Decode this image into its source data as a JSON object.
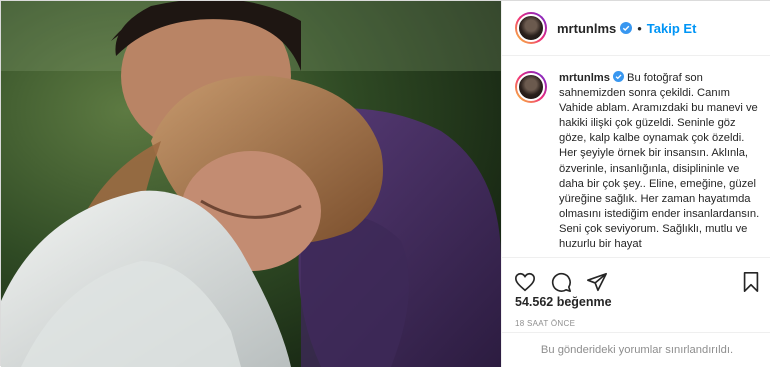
{
  "post": {
    "username": "mrtunlms",
    "follow_label": "Takip Et",
    "dot": "•",
    "caption_text": "Bu fotoğraf son sahnemizden sonra çekildi. Canım Vahide ablam. Aramızdaki bu manevi ve hakiki ilişki çok güzeldi. Seninle göz göze, kalp kalbe oynamak çok özeldi. Her şeyiyle örnek bir insansın. Aklınla, özverinle, insanlığınla, disiplininle ve daha bir çok şey.. Eline, emeğine, güzel yüreğine sağlık. Her zaman hayatımda olmasını istediğim ender insanlardansın. Seni çok seviyorum. Sağlıklı, mutlu ve huzurlu bir hayat",
    "likes": "54.562 beğenme",
    "time_ago": "18 SAAT ÖNCE",
    "comments_disabled": "Bu gönderideki yorumlar sınırlandırıldı."
  },
  "icons": {
    "verified": "verified-badge-icon",
    "like": "heart-icon",
    "comment": "comment-icon",
    "share": "share-icon",
    "save": "bookmark-icon"
  },
  "colors": {
    "accent": "#0095f6",
    "text": "#262626",
    "muted": "#8e8e8e",
    "border": "#dbdbdb"
  }
}
